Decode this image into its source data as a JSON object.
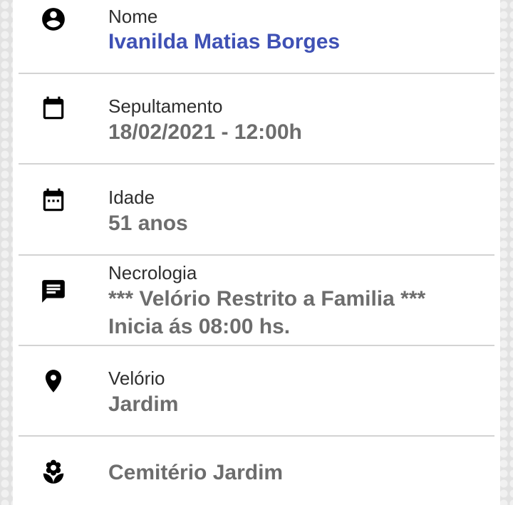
{
  "rows": [
    {
      "label": "Nome",
      "value": "Ivanilda Matias Borges",
      "icon": "account-circle-icon"
    },
    {
      "label": "Sepultamento",
      "value": "18/02/2021 - 12:00h",
      "icon": "calendar-icon"
    },
    {
      "label": "Idade",
      "value": "51 anos",
      "icon": "calendar-dots-icon"
    },
    {
      "label": "Necrologia",
      "value_line1": "*** Velório Restrito a Familia ***",
      "value_line2": "Inicia ás 08:00 hs.",
      "icon": "message-icon"
    },
    {
      "label": "Velório",
      "value": "Jardim",
      "icon": "location-pin-icon"
    },
    {
      "value": "Cemitério Jardim",
      "icon": "flower-icon"
    }
  ],
  "colors": {
    "name_accent": "#3f51b5",
    "value_gray": "#6d6d6d",
    "label_dark": "#2e2e2e",
    "divider": "#d3d3d3"
  }
}
